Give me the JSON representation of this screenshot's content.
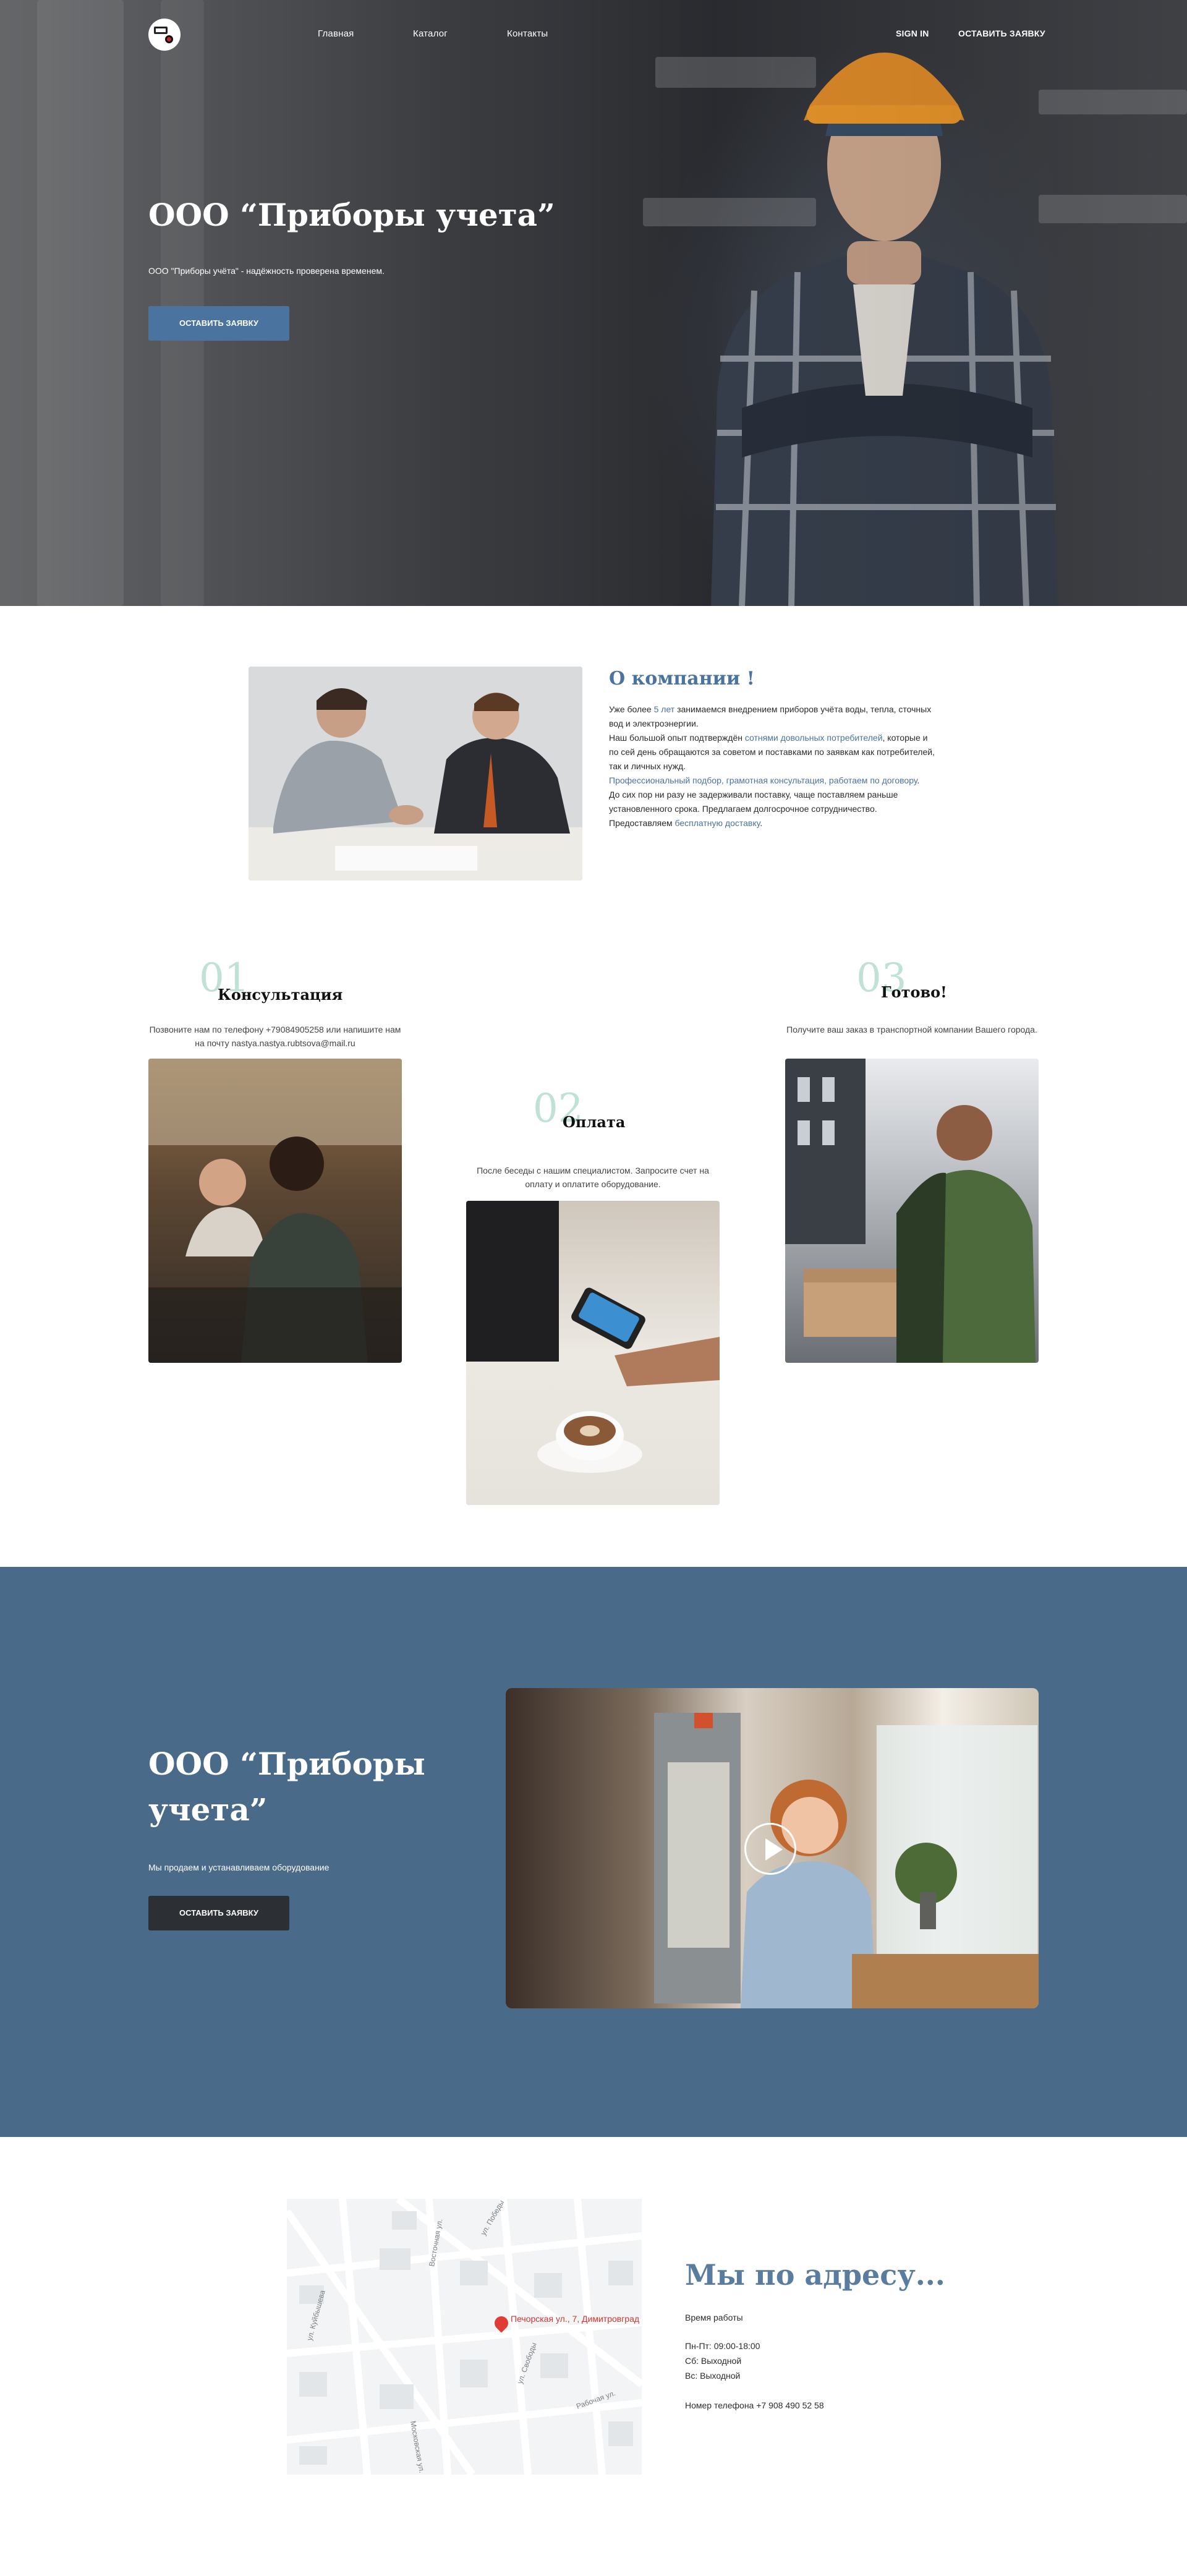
{
  "nav": {
    "links": [
      "Главная",
      "Каталог",
      "Контакты"
    ],
    "sign_in": "SIGN IN",
    "cta": "ОСТАВИТЬ ЗАЯВКУ"
  },
  "hero": {
    "title": "ООО “Приборы учета”",
    "subtitle": "ООО \"Приборы учёта\" - надёжность проверена временем.",
    "button": "ОСТАВИТЬ ЗАЯВКУ"
  },
  "about": {
    "title": "О компании !",
    "text": [
      [
        "Уже более ",
        "5 лет",
        " занимаемся внедрением приборов учёта воды, тепла, сточных вод и электроэнергии."
      ],
      [
        "Наш большой опыт подтверждён ",
        "сотнями довольных потребителей",
        ", которые и по сей день обращаются за советом и поставками по заявкам как потребителей, так и личных нужд."
      ],
      [
        "",
        "Профессиональный подбор, грамотная консультация, работаем по договору",
        "."
      ],
      [
        "До сих пор ни разу не задерживали поставку, чаще поставляем раньше установленного срока. Предлагаем долгосрочное сотрудничество.",
        "",
        ""
      ],
      [
        "Предоставляем ",
        "бесплатную доставку",
        "."
      ]
    ]
  },
  "steps": [
    {
      "num": "01",
      "title": "Консультация",
      "desc": "Позвоните нам по телефону +79084905258 или напишите нам на почту nastya.nastya.rubtsova@mail.ru"
    },
    {
      "num": "02",
      "title": "Оплата",
      "desc": "После беседы с нашим специалистом. Запросите счет на оплату и оплатите оборудование."
    },
    {
      "num": "03",
      "title": "Готово!",
      "desc": "Получите ваш заказ в транспортной компании Вашего города."
    }
  ],
  "promo": {
    "title": "ООО “Приборы учета”",
    "subtitle": "Мы продаем и устанавливаем оборудование",
    "button": "ОСТАВИТЬ ЗАЯВКУ"
  },
  "map": {
    "pin_label": "Печорская ул., 7, Димитровград",
    "streets": [
      "ул. Победы",
      "Восточная ул.",
      "ул. Свободы",
      "ул. Куйбышева",
      "Московская ул.",
      "Рабочая ул."
    ]
  },
  "address": {
    "title": "Мы по адресу...",
    "hours_label": "Время работы",
    "hours": [
      "Пн-Пт: 09:00-18:00",
      "Сб: Выходной",
      "Вс: Выходной"
    ],
    "phone": "Номер телефона +7 908 490 52 58"
  }
}
